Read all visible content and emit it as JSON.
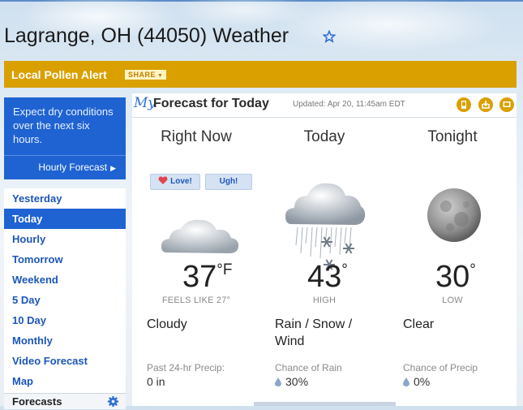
{
  "page": {
    "title": "Lagrange, OH (44050) Weather"
  },
  "pollen": {
    "label": "Local Pollen Alert",
    "share": "SHARE"
  },
  "promo": {
    "text": "Expect dry conditions over the next six hours.",
    "link": "Hourly Forecast"
  },
  "nav": {
    "items": [
      "Yesterday",
      "Today",
      "Hourly",
      "Tomorrow",
      "Weekend",
      "5 Day",
      "10 Day",
      "Monthly",
      "Video Forecast",
      "Map"
    ],
    "active": "Today",
    "footer": "Forecasts"
  },
  "forecast": {
    "logo": "My",
    "title": "Forecast for Today",
    "updated": "Updated: Apr 20, 11:45am EDT",
    "right_now": {
      "heading": "Right Now",
      "love": "Love!",
      "ugh": "Ugh!",
      "temp": "37",
      "unit": "°F",
      "sub": "FEELS LIKE 27°",
      "condition": "Cloudy",
      "precip_label": "Past 24-hr Precip:",
      "precip_value": "0 in",
      "icon": "cloudy-icon"
    },
    "today": {
      "heading": "Today",
      "temp": "43",
      "unit": "°",
      "sub": "HIGH",
      "condition": "Rain / Snow / Wind",
      "precip_label": "Chance of Rain",
      "precip_value": "30%",
      "icon": "rain-snow-wind-icon"
    },
    "tonight": {
      "heading": "Tonight",
      "temp": "30",
      "unit": "°",
      "sub": "LOW",
      "condition": "Clear",
      "precip_label": "Chance of Precip",
      "precip_value": "0%",
      "icon": "moon-icon"
    }
  },
  "colors": {
    "accent": "#1f63d2",
    "pollen": "#d9a000",
    "link": "#1d56b8"
  }
}
